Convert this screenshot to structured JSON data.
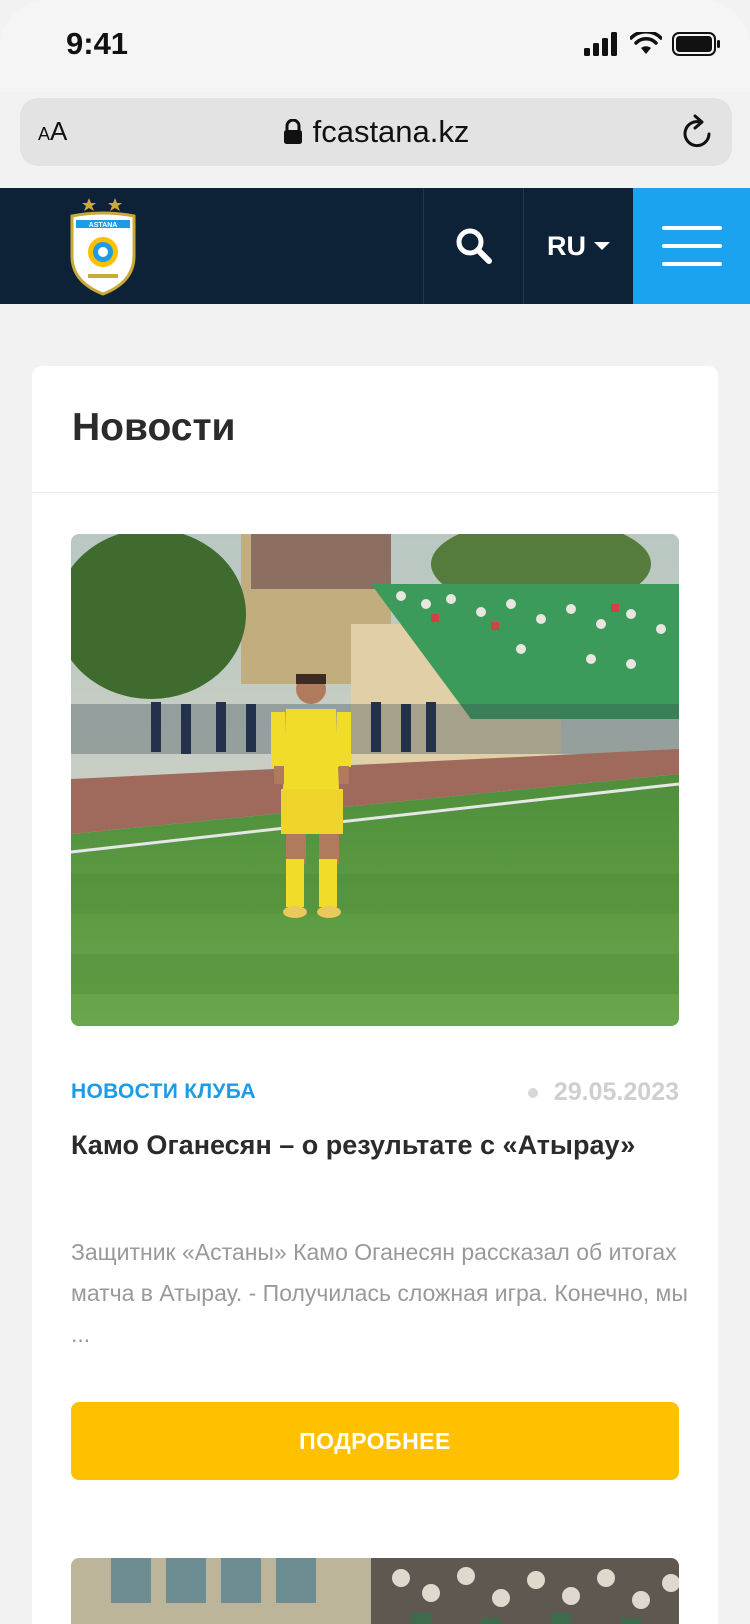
{
  "status_bar": {
    "time": "9:41"
  },
  "browser": {
    "aa_label_small": "A",
    "aa_label_large": "A",
    "url": "fcastana.kz"
  },
  "header": {
    "language": "RU"
  },
  "news_section": {
    "title": "Новости",
    "items": [
      {
        "category": "НОВОСТИ КЛУБА",
        "date": "29.05.2023",
        "headline": "Камо Оганесян – о результате с «Атырау»",
        "excerpt": "Защитник «Астаны» Камо Оганесян рассказал об итогах матча в Атырау. - Получилась сложная игра. Конечно, мы ...",
        "button_label": "ПОДРОБНЕЕ"
      }
    ]
  },
  "colors": {
    "header_bg": "#0d2137",
    "menu_accent": "#1ca3f0",
    "button": "#ffc000",
    "category": "#1c9be6"
  },
  "icons": [
    "signal-icon",
    "wifi-icon",
    "battery-icon",
    "lock-icon",
    "reload-icon",
    "search-icon",
    "caret-down-icon",
    "hamburger-menu-icon",
    "club-logo"
  ]
}
